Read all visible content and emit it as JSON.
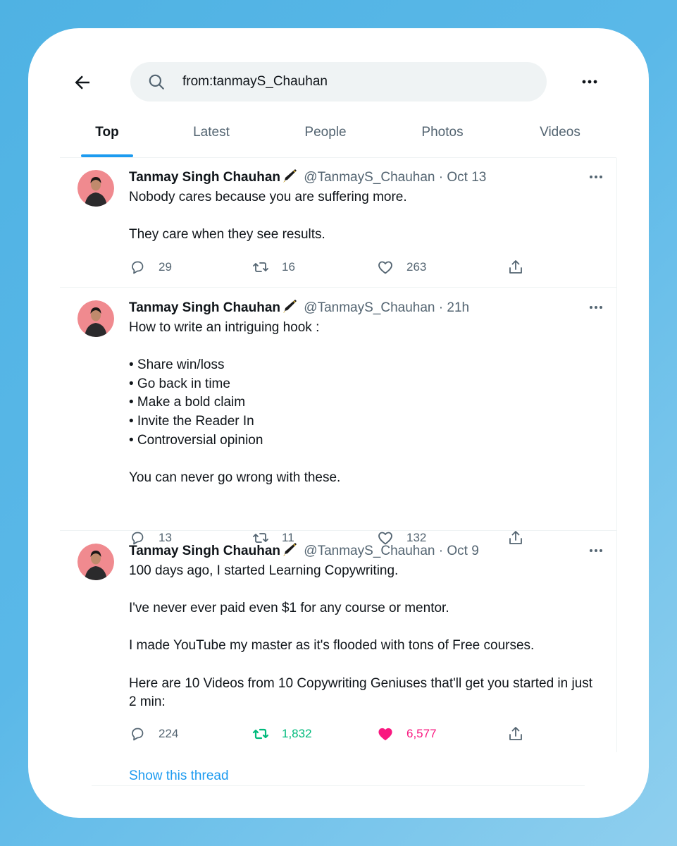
{
  "search": {
    "value": "from:tanmayS_Chauhan",
    "back_icon": "arrow-left-icon",
    "search_icon": "magnifier-icon",
    "more_icon": "more-horizontal-icon"
  },
  "tabs": [
    {
      "label": "Top",
      "active": true
    },
    {
      "label": "Latest",
      "active": false
    },
    {
      "label": "People",
      "active": false
    },
    {
      "label": "Photos",
      "active": false
    },
    {
      "label": "Videos",
      "active": false
    }
  ],
  "colors": {
    "accent": "#1d9bf0",
    "retweeted": "#00ba7c",
    "liked": "#f91880",
    "muted": "#536471",
    "background": "#4fb2e3"
  },
  "tweets": [
    {
      "author": "Tanmay Singh Chauhan",
      "handle": "@TanmayS_Chauhan",
      "time": "· Oct 13",
      "paragraphs": [
        "Nobody cares because you are suffering more.",
        "They care when they see results."
      ],
      "replies": "29",
      "retweets": "16",
      "likes": "263"
    },
    {
      "author": "Tanmay Singh Chauhan",
      "handle": "@TanmayS_Chauhan",
      "time": "· 21h",
      "paragraphs": [
        "How to write an intriguing hook :",
        "• Share win/loss\n• Go back in time\n• Make a bold claim\n• Invite the Reader In\n• Controversial opinion",
        "You can never go wrong with these."
      ],
      "replies": "13",
      "retweets": "11",
      "likes": "132"
    },
    {
      "author": "Tanmay Singh Chauhan",
      "handle": "@TanmayS_Chauhan",
      "time": "· Oct 9",
      "paragraphs": [
        "100 days ago, I started Learning Copywriting.",
        "I've never ever paid even $1 for any course or mentor.",
        "I made YouTube my master as it's flooded with tons of Free courses.",
        "Here are 10 Videos from 10 Copywriting Geniuses that'll get you started in just 2 min:"
      ],
      "replies": "224",
      "retweets": "1,832",
      "likes": "6,577",
      "retweeted": true,
      "liked": true
    }
  ],
  "show_thread": "Show this thread"
}
